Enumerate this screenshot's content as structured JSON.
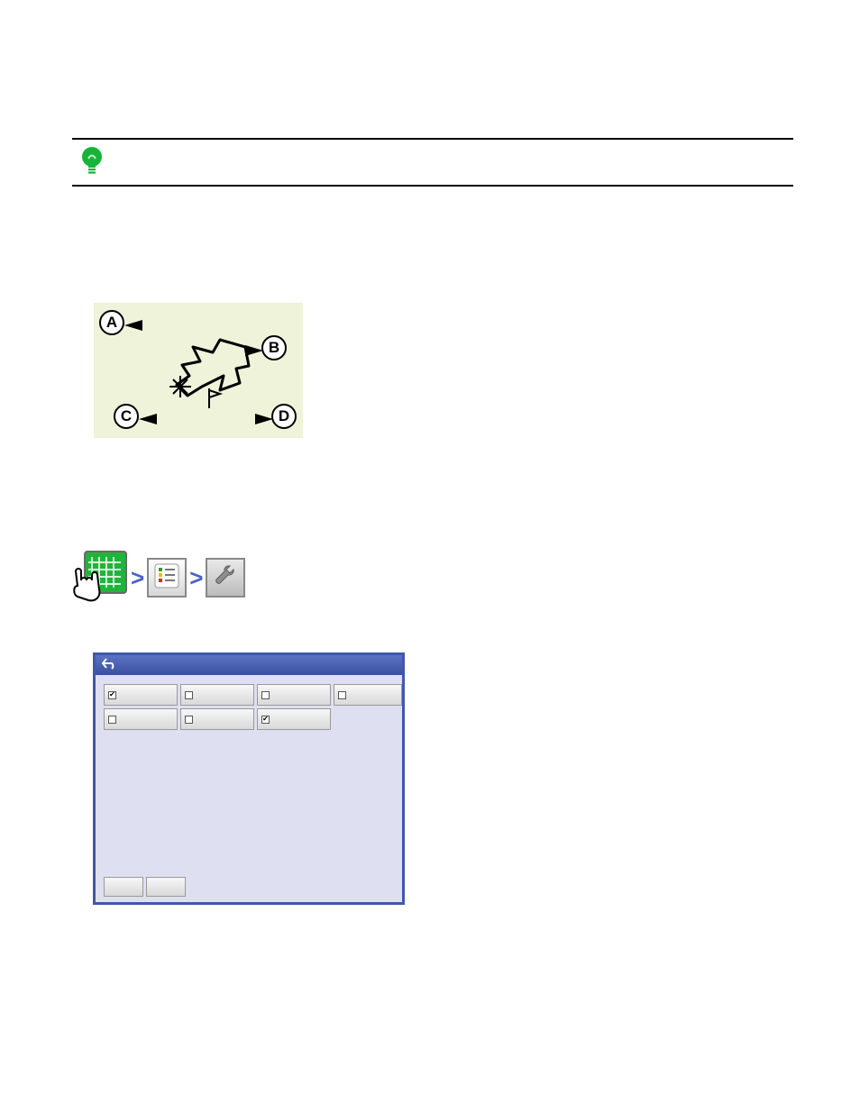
{
  "callouts": {
    "a": "A",
    "b": "B",
    "c": "C",
    "d": "D"
  },
  "separator": ">",
  "dialog": {
    "row1": [
      {
        "checked": true
      },
      {
        "checked": false
      },
      {
        "checked": false
      },
      {
        "checked": false
      }
    ],
    "row2": [
      {
        "checked": false
      },
      {
        "checked": false
      },
      {
        "checked": true
      }
    ]
  }
}
